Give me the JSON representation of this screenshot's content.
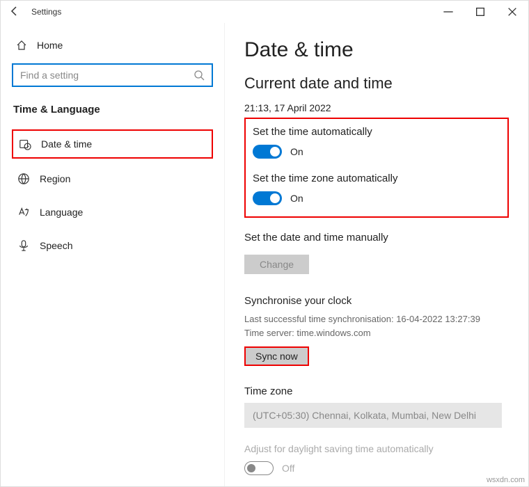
{
  "titlebar": {
    "title": "Settings"
  },
  "sidebar": {
    "home": "Home",
    "search_placeholder": "Find a setting",
    "category": "Time & Language",
    "items": [
      {
        "label": "Date & time"
      },
      {
        "label": "Region"
      },
      {
        "label": "Language"
      },
      {
        "label": "Speech"
      }
    ]
  },
  "content": {
    "heading": "Date & time",
    "subheading": "Current date and time",
    "now": "21:13, 17 April 2022",
    "auto_time_label": "Set the time automatically",
    "auto_time_state": "On",
    "auto_tz_label": "Set the time zone automatically",
    "auto_tz_state": "On",
    "manual_label": "Set the date and time manually",
    "change_btn": "Change",
    "sync_heading": "Synchronise your clock",
    "sync_last": "Last successful time synchronisation: 16-04-2022 13:27:39",
    "sync_server": "Time server: time.windows.com",
    "sync_btn": "Sync now",
    "tz_heading": "Time zone",
    "tz_value": "(UTC+05:30) Chennai, Kolkata, Mumbai, New Delhi",
    "dst_label": "Adjust for daylight saving time automatically",
    "dst_state": "Off"
  },
  "watermark": "wsxdn.com"
}
